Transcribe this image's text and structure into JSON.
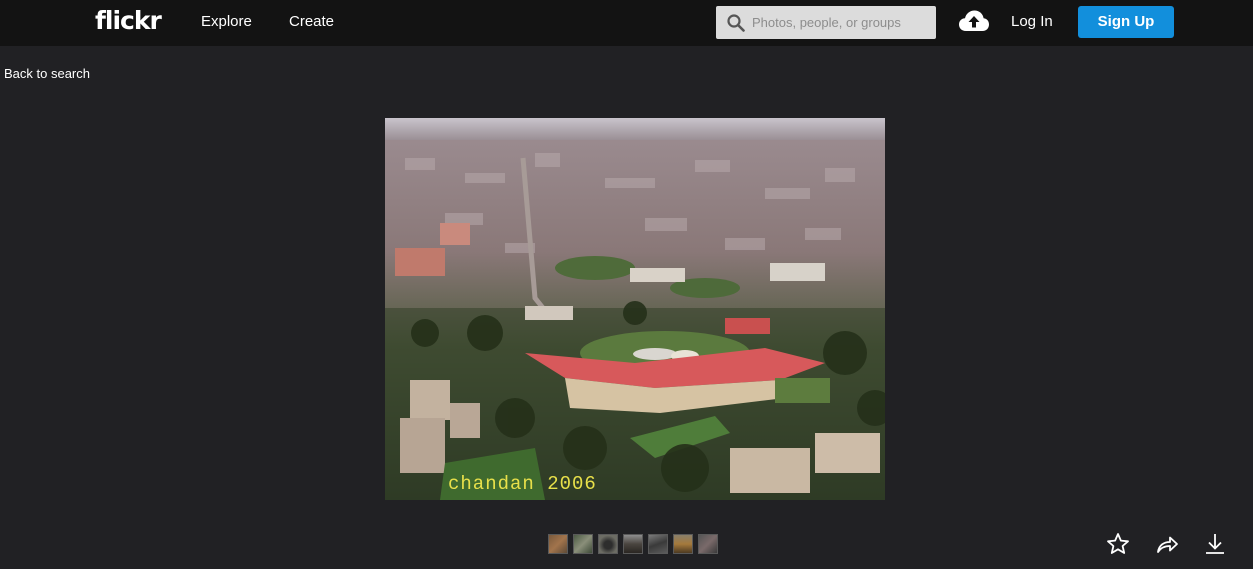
{
  "header": {
    "logo": "flickr",
    "nav": {
      "explore": "Explore",
      "create": "Create"
    },
    "search": {
      "placeholder": "Photos, people, or groups",
      "value": ""
    },
    "upload_icon": "cloud-upload-icon",
    "login": "Log In",
    "signup": "Sign Up"
  },
  "colors": {
    "background": "#212124",
    "topbar": "#131313",
    "signup_accent": "#128fdc",
    "watermark": "#e8e04a"
  },
  "back_link": "Back to search",
  "photo": {
    "watermark": "chandan 2006"
  },
  "thumbnails": [
    {
      "icon": "thumbnail-1"
    },
    {
      "icon": "thumbnail-2"
    },
    {
      "icon": "thumbnail-3"
    },
    {
      "icon": "thumbnail-4"
    },
    {
      "icon": "thumbnail-5"
    },
    {
      "icon": "thumbnail-6"
    },
    {
      "icon": "thumbnail-7"
    }
  ],
  "actions": {
    "favorite_icon": "star-icon",
    "share_icon": "share-icon",
    "download_icon": "download-icon"
  }
}
